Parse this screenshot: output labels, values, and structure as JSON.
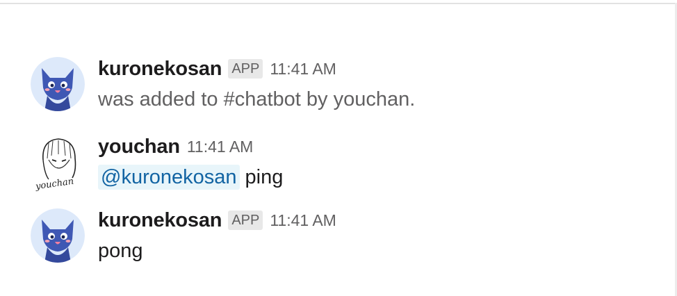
{
  "messages": [
    {
      "sender": "kuronekosan",
      "badge": "APP",
      "time": "11:41 AM",
      "text": "was added to #chatbot by youchan.",
      "avatar_icon": "cat-bot-avatar-icon"
    },
    {
      "sender": "youchan",
      "time": "11:41 AM",
      "mention": "@kuronekosan",
      "text": " ping",
      "avatar_icon": "sketch-girl-avatar-icon",
      "avatar_signature": "youchan"
    },
    {
      "sender": "kuronekosan",
      "badge": "APP",
      "time": "11:41 AM",
      "text": "pong",
      "avatar_icon": "cat-bot-avatar-icon"
    }
  ],
  "colors": {
    "sender": "#1d1c1d",
    "time": "#616061",
    "badge_bg": "#e8e8e8",
    "mention_bg": "#e8f5fa",
    "mention_text": "#1264a3",
    "cat_fill": "#3f58b4",
    "avatar_bg": "#dde9fa"
  }
}
